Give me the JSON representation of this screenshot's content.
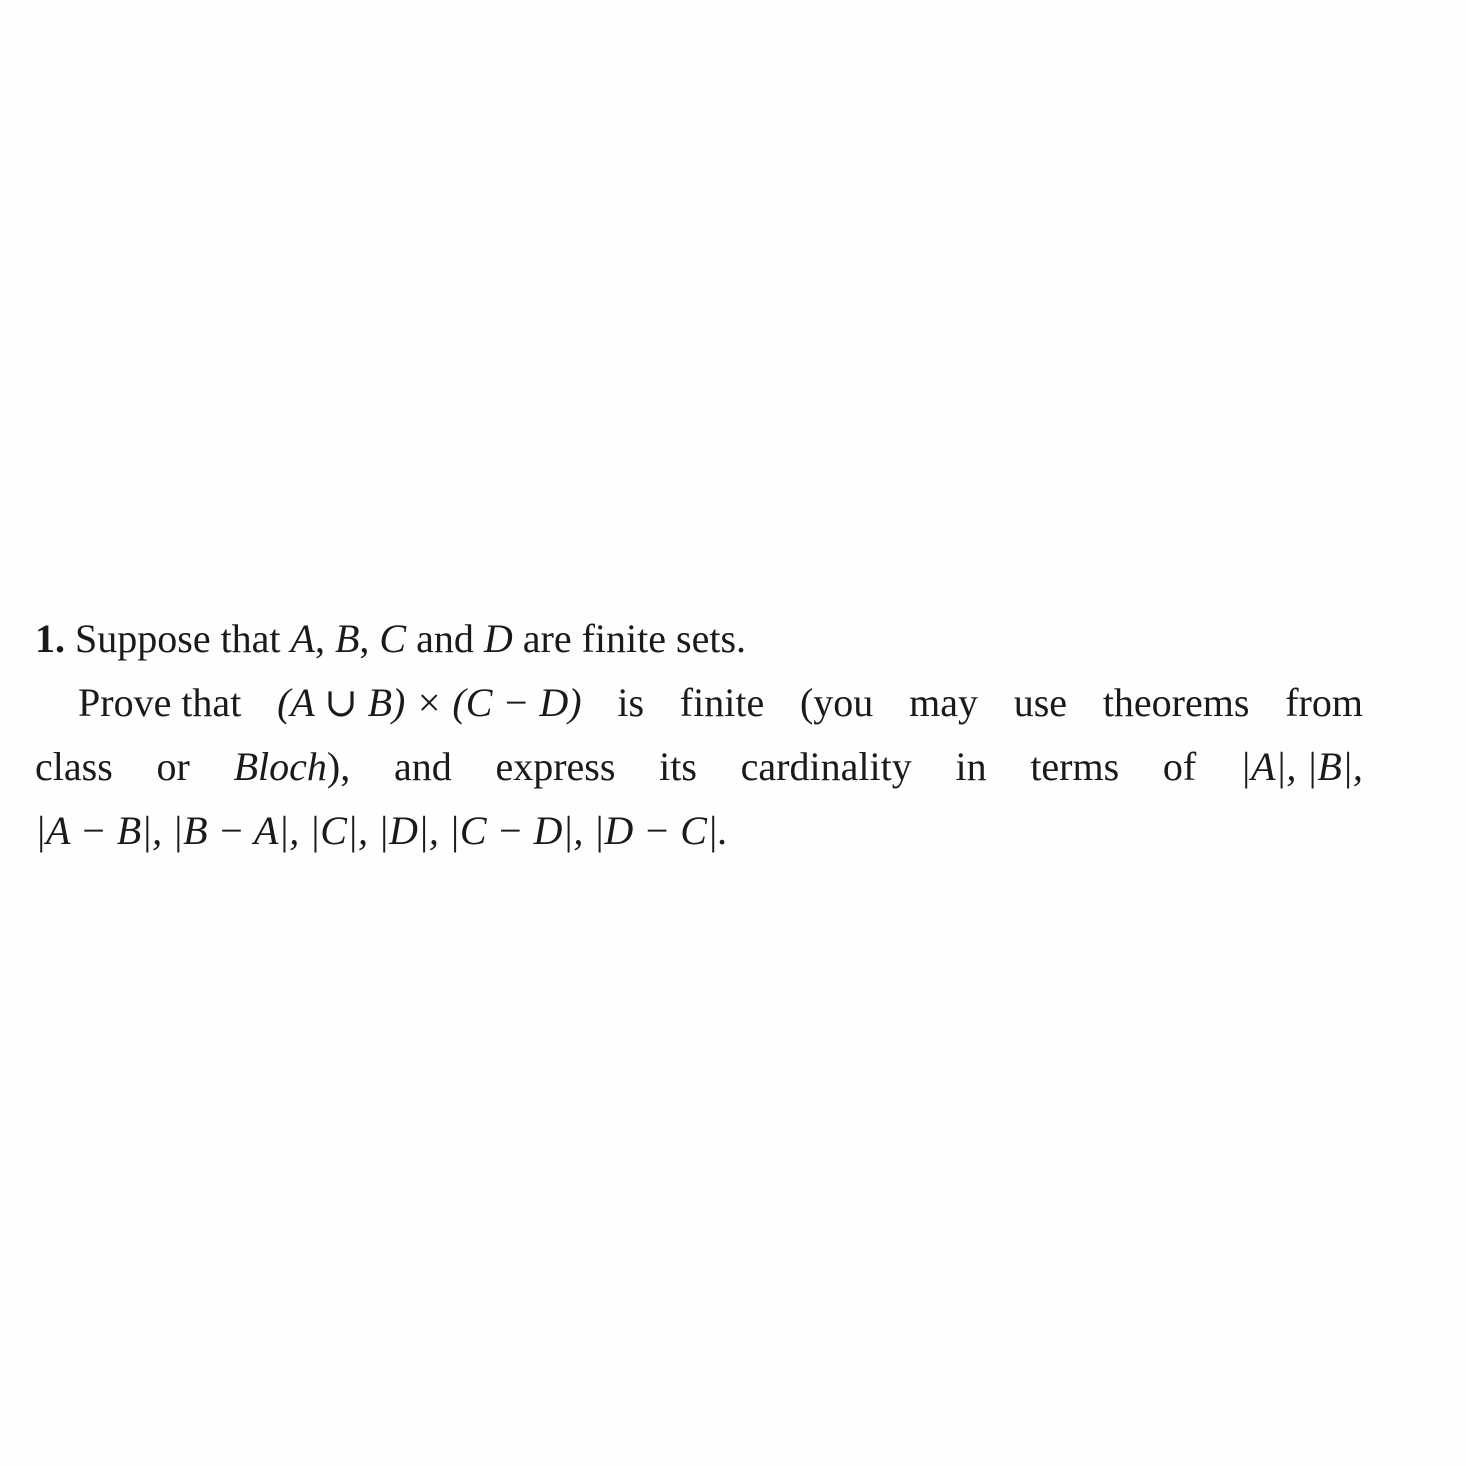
{
  "problem": {
    "number": "1.",
    "line1": {
      "text": "Suppose that",
      "sets": [
        "A",
        "B",
        "C",
        "D"
      ],
      "and": "and",
      "tail": "are finite sets."
    },
    "line2": {
      "prefix": "Prove that",
      "expression": "(A ∪ B) × (C − D)",
      "words": [
        "is",
        "finite",
        "(you",
        "may",
        "use",
        "theorems",
        "from"
      ]
    },
    "line3": {
      "words_before": [
        "class",
        "or"
      ],
      "reference": "Bloch",
      "after_reference": "),",
      "words": [
        "and",
        "express",
        "its",
        "cardinality",
        "in",
        "terms",
        "of"
      ],
      "terms": [
        "|A|,",
        "|B|,"
      ]
    },
    "line4": {
      "terms": [
        "|A − B|,",
        "|B − A|,",
        "|C|,",
        "|D|,",
        "|C − D|,",
        "|D − C|."
      ]
    }
  }
}
